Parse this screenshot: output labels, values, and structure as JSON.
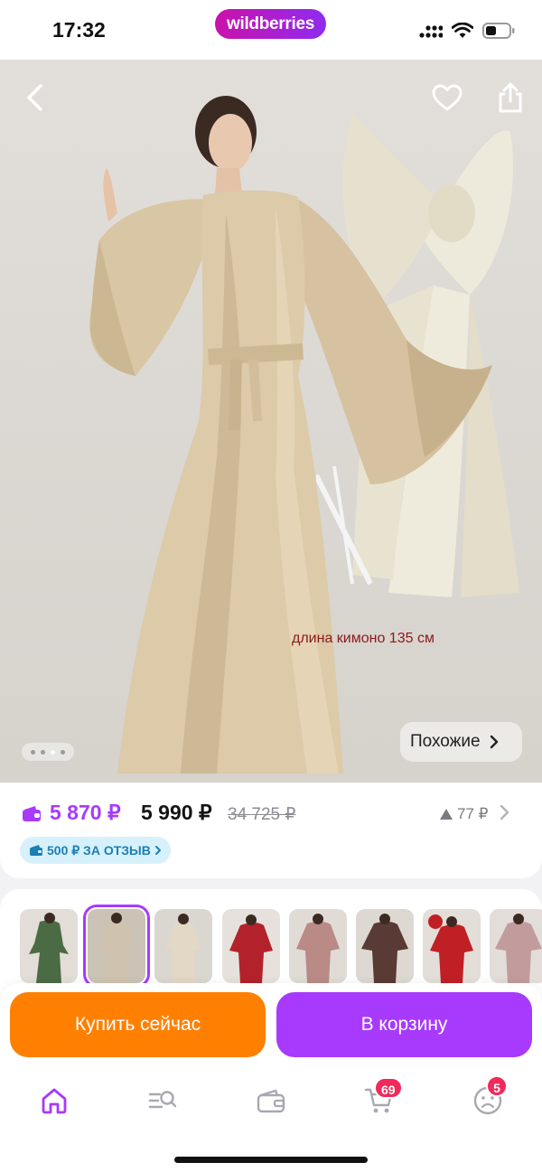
{
  "status_bar": {
    "time": "17:32",
    "brand": "wildberries"
  },
  "product": {
    "image_caption": "длина кимоно 135 см",
    "similar_label": "Похожие",
    "gallery": {
      "total_dots": 4,
      "active_index": 2
    }
  },
  "price": {
    "wallet_price": "5 870 ₽",
    "current_price": "5 990 ₽",
    "old_price": "34 725 ₽",
    "price_change": "77 ₽",
    "review_bonus": "500 ₽ ЗА ОТЗЫВ"
  },
  "colors": {
    "accent": "#a73afd",
    "buy_button": "#ff8000",
    "badge": "#f02a5a",
    "bonus_chip_bg": "#d6f1fb",
    "bonus_chip_text": "#1c7fb5"
  },
  "variants": [
    {
      "name": "green-kimono",
      "color": "#4b6b45",
      "selected": false
    },
    {
      "name": "beige-kimono",
      "color": "#cfc2ae",
      "selected": true
    },
    {
      "name": "cream-kimono",
      "color": "#e3d8c6",
      "selected": false
    },
    {
      "name": "red-kimono",
      "color": "#b3222a",
      "selected": false
    },
    {
      "name": "rose-kimono",
      "color": "#b98a86",
      "selected": false
    },
    {
      "name": "chocolate-kimono",
      "color": "#5a3a34",
      "selected": false
    },
    {
      "name": "crimson-kimono",
      "color": "#c01f26",
      "selected": false
    },
    {
      "name": "dusty-pink-kimono",
      "color": "#c29c9c",
      "selected": false
    }
  ],
  "actions": {
    "buy_now": "Купить сейчас",
    "add_to_cart": "В корзину"
  },
  "tab_bar": {
    "items": [
      {
        "icon": "home-icon",
        "active": true
      },
      {
        "icon": "catalog-search-icon",
        "active": false
      },
      {
        "icon": "wallet-icon",
        "active": false
      },
      {
        "icon": "cart-icon",
        "active": false,
        "badge": "69"
      },
      {
        "icon": "profile-icon",
        "active": false,
        "badge": "5"
      }
    ]
  }
}
